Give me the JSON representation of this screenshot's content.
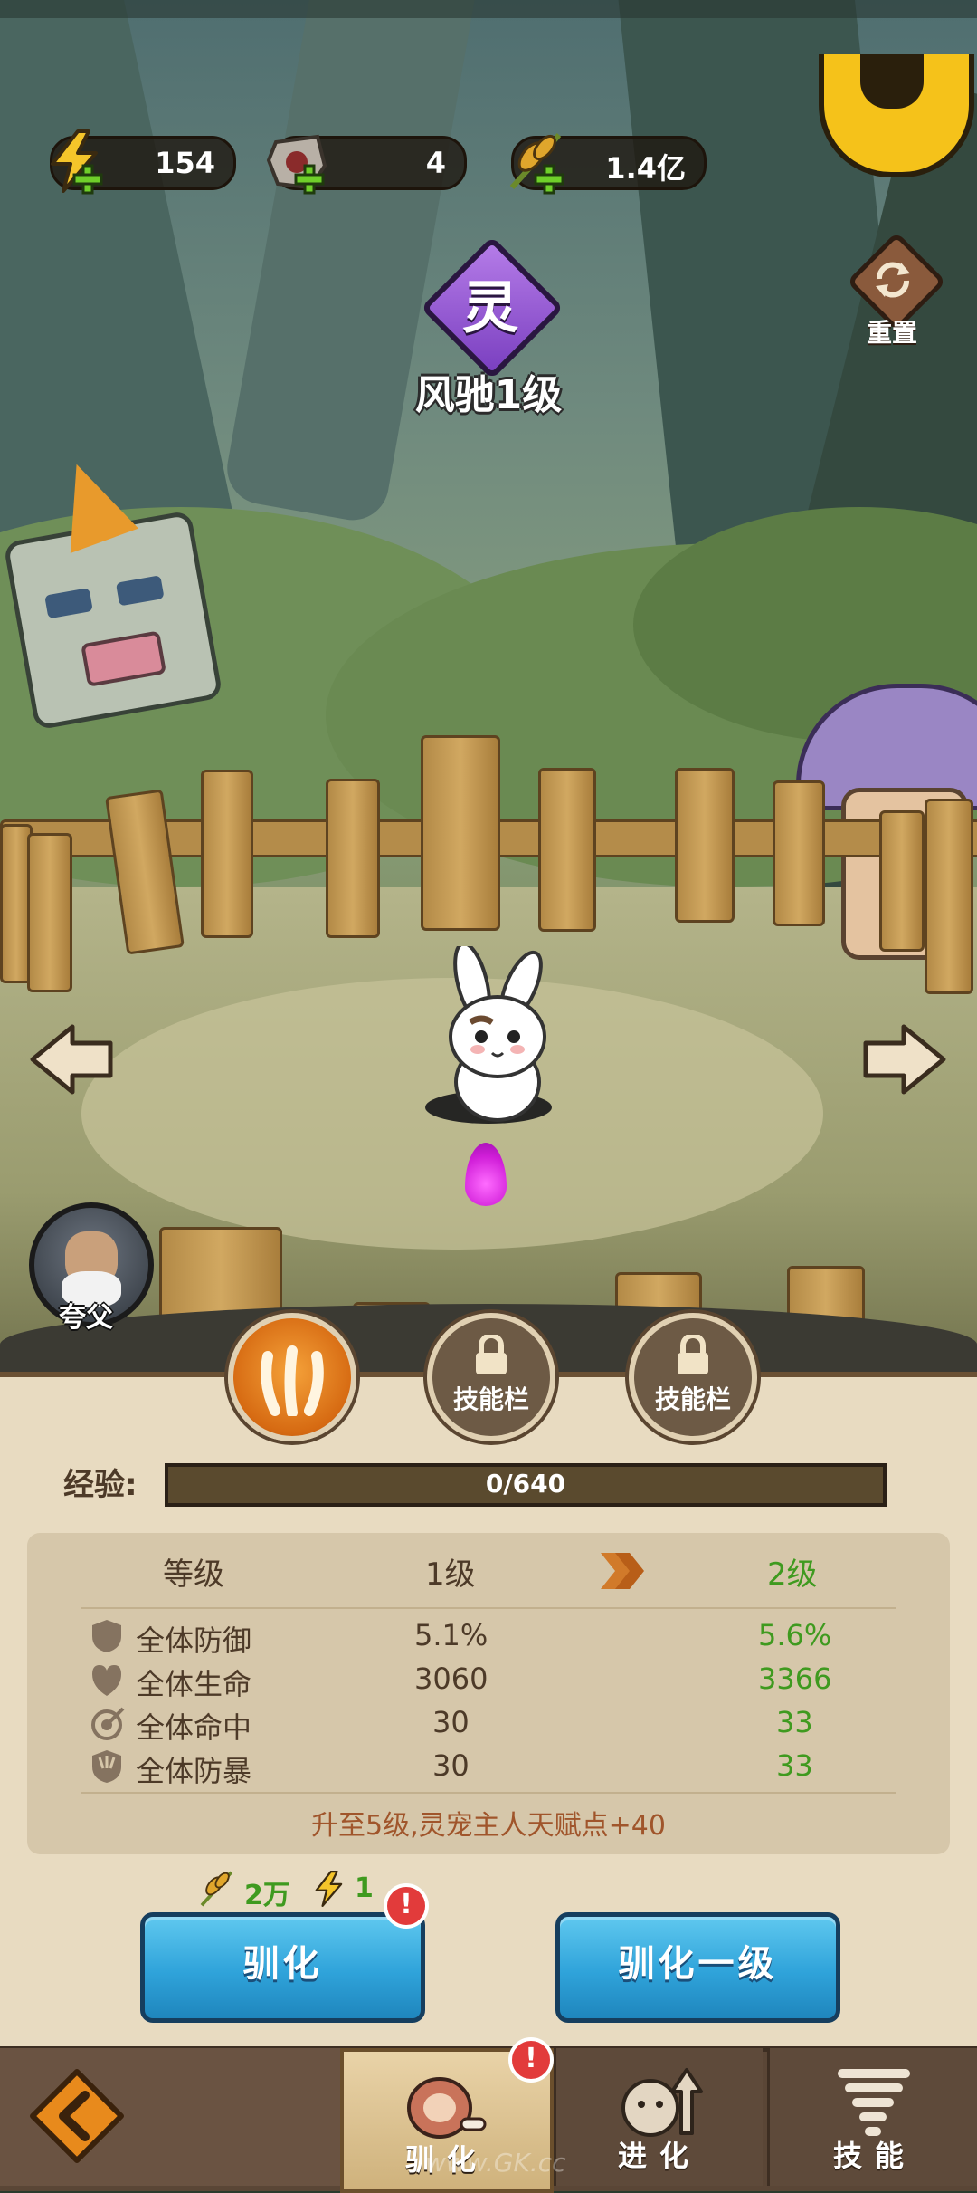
{
  "resources": [
    {
      "name": "energy",
      "icon": "lightning-icon",
      "value": "154"
    },
    {
      "name": "stone-token",
      "icon": "boar-stone-icon",
      "value": "4"
    },
    {
      "name": "grain",
      "icon": "grain-icon",
      "value": "1.4亿"
    }
  ],
  "pet": {
    "rank_glyph": "灵",
    "name_level": "风驰1级"
  },
  "reset": {
    "label": "重置"
  },
  "hero": {
    "name": "夸父"
  },
  "skills": {
    "locked_label_1": "技能栏",
    "locked_label_2": "技能栏"
  },
  "experience": {
    "label": "经验:",
    "value": "0/640",
    "progress": 0
  },
  "stats": {
    "header": {
      "col1": "等级",
      "current": "1级",
      "next": "2级"
    },
    "rows": [
      {
        "icon": "shield-icon",
        "label": "全体防御",
        "current": "5.1%",
        "next": "5.6%"
      },
      {
        "icon": "heart-shield-icon",
        "label": "全体生命",
        "current": "3060",
        "next": "3366"
      },
      {
        "icon": "target-icon",
        "label": "全体命中",
        "current": "30",
        "next": "33"
      },
      {
        "icon": "claw-shield-icon",
        "label": "全体防暴",
        "current": "30",
        "next": "33"
      }
    ],
    "note": "升至5级,灵宠主人天赋点+40"
  },
  "cost": {
    "grain": "2万",
    "energy": "1"
  },
  "buttons": {
    "tame": "驯化",
    "tame_one_level": "驯化一级",
    "alert_mark": "!"
  },
  "nav": {
    "tabs": [
      {
        "label": "驯化",
        "icon": "meat-bone-icon",
        "active": true,
        "badge": "!"
      },
      {
        "label": "进化",
        "icon": "evolve-pet-icon",
        "active": false
      },
      {
        "label": "技能",
        "icon": "tornado-icon",
        "active": false
      }
    ]
  },
  "watermark": "www.GK.cc",
  "colors": {
    "next_value": "#3f9a1f",
    "note_text": "#a0552b",
    "button_blue": "#2fa3da",
    "panel_bg": "#e8dbc1"
  }
}
